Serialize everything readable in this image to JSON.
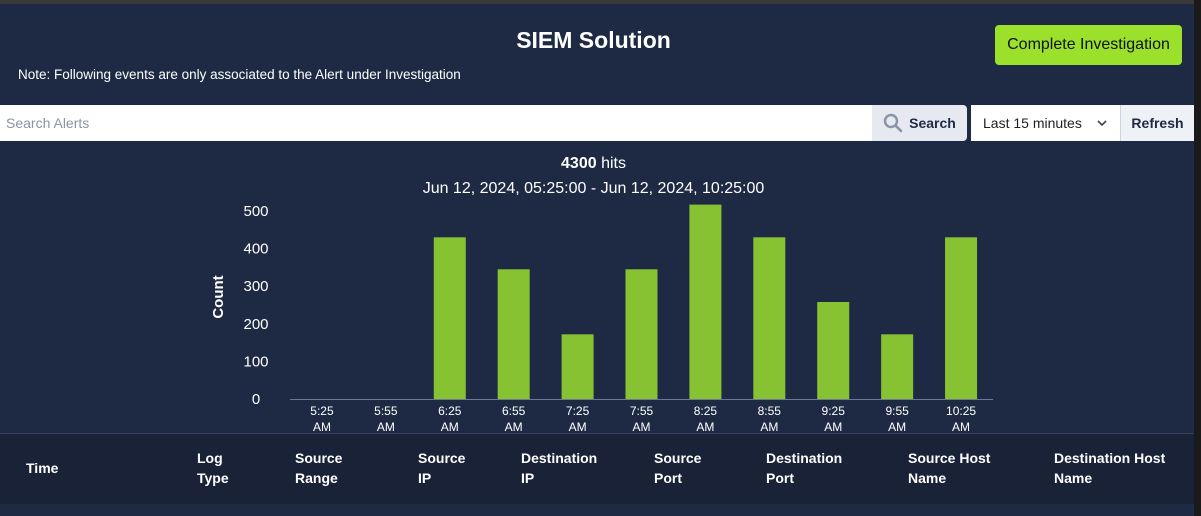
{
  "header": {
    "title": "SIEM Solution",
    "note": "Note: Following events are only associated to the Alert under Investigation",
    "complete_label": "Complete Investigation"
  },
  "search": {
    "placeholder": "Search Alerts",
    "button_label": "Search",
    "search_icon": "search-icon"
  },
  "time_filter": {
    "selected": "Last 15 minutes",
    "chevron_icon": "chevron-down-icon"
  },
  "refresh_label": "Refresh",
  "summary": {
    "hits_count": "4300",
    "hits_suffix": " hits",
    "range": "Jun 12, 2024, 05:25:00 - Jun 12, 2024, 10:25:00"
  },
  "colors": {
    "bar": "#86c232",
    "accent": "#9be02a",
    "background": "#1e2a44"
  },
  "chart_data": {
    "type": "bar",
    "ylabel": "Count",
    "xlabel": "",
    "ylim": [
      0,
      500
    ],
    "yticks": [
      0,
      100,
      200,
      300,
      400,
      500
    ],
    "grid": false,
    "categories": [
      [
        "5:25",
        "AM"
      ],
      [
        "5:55",
        "AM"
      ],
      [
        "6:25",
        "AM"
      ],
      [
        "6:55",
        "AM"
      ],
      [
        "7:25",
        "AM"
      ],
      [
        "7:55",
        "AM"
      ],
      [
        "8:25",
        "AM"
      ],
      [
        "8:55",
        "AM"
      ],
      [
        "9:25",
        "AM"
      ],
      [
        "9:55",
        "AM"
      ],
      [
        "10:25",
        "AM"
      ]
    ],
    "values": [
      0,
      0,
      430,
      345,
      172,
      345,
      517,
      430,
      258,
      172,
      430
    ]
  },
  "table": {
    "columns": [
      [
        "Time"
      ],
      [
        "Log",
        "Type"
      ],
      [
        "Source",
        "Range"
      ],
      [
        "Source",
        "IP"
      ],
      [
        "Destination",
        "IP"
      ],
      [
        "Source",
        "Port"
      ],
      [
        "Destination",
        "Port"
      ],
      [
        "Source Host",
        "Name"
      ],
      [
        "Destination Host",
        "Name"
      ]
    ]
  }
}
